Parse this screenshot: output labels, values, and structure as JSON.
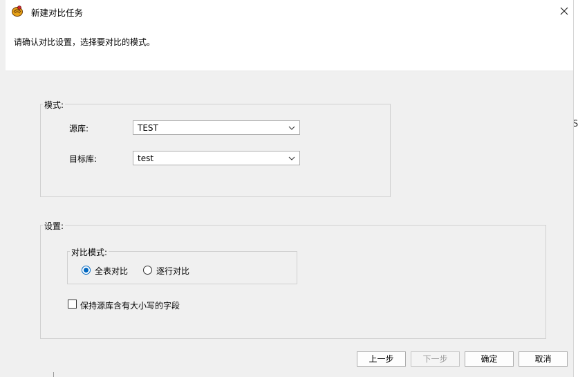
{
  "window": {
    "title": "新建对比任务",
    "icon": "app-compare-icon"
  },
  "header": {
    "subtitle": "请确认对比设置，选择要对比的模式。"
  },
  "mode_group": {
    "label": "模式:",
    "source": {
      "label": "源库:",
      "value": "TEST"
    },
    "target": {
      "label": "目标库:",
      "value": "test"
    }
  },
  "settings_group": {
    "label": "设置:",
    "compare_mode": {
      "label": "对比模式:",
      "options": [
        "全表对比",
        "逐行对比"
      ],
      "selected": "全表对比"
    },
    "keep_case_checkbox": {
      "label": "保持源库含有大小写的字段",
      "checked": false
    }
  },
  "buttons": {
    "back": "上一步",
    "next": "下一步",
    "ok": "确定",
    "cancel": "取消"
  },
  "backdrop": {
    "partial_char": "S"
  },
  "colors": {
    "accent": "#0067c0",
    "dialog_bg": "#f0f0f0",
    "header_bg": "#ffffff"
  }
}
